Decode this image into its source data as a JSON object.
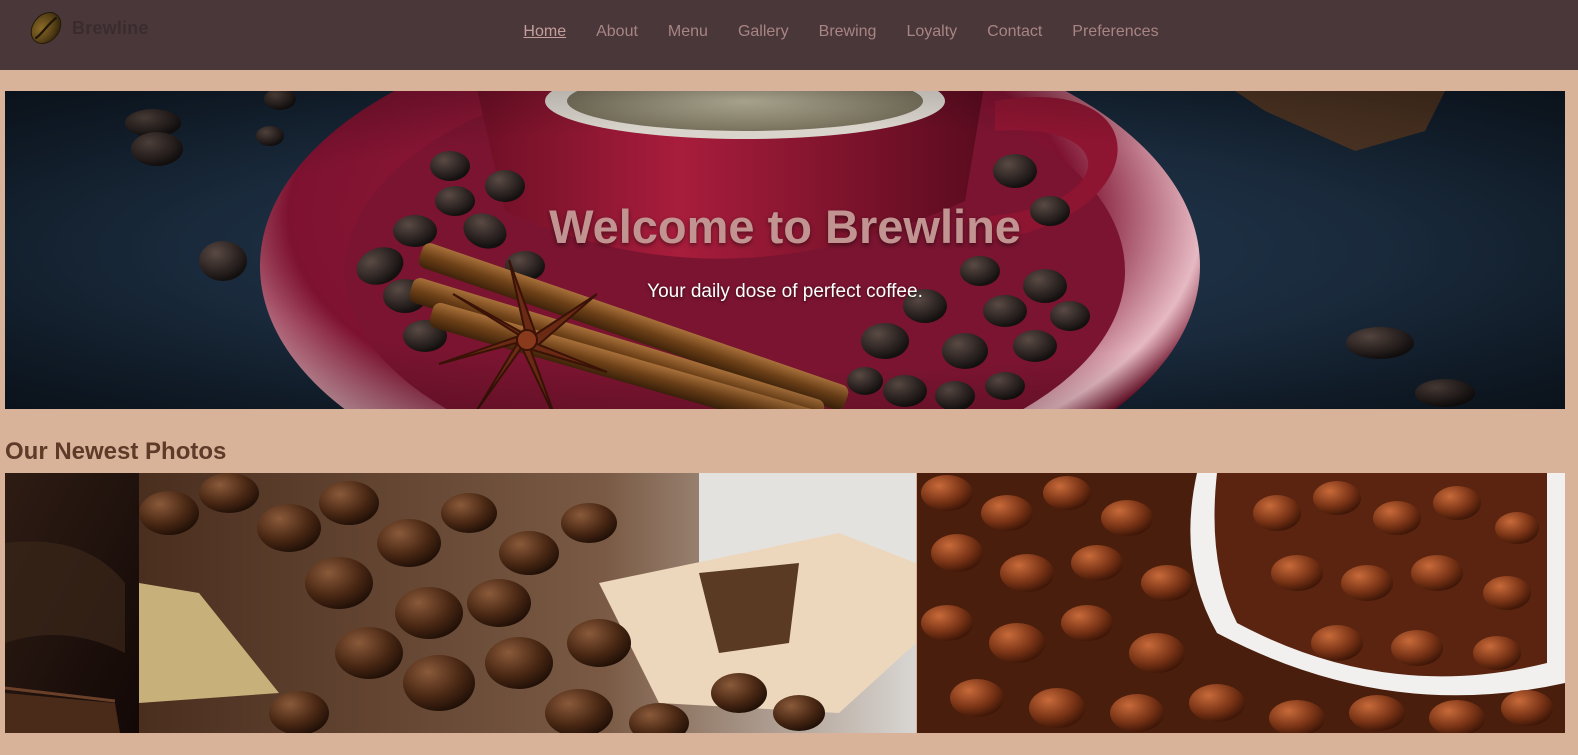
{
  "brand": {
    "name": "Brewline",
    "logo_icon": "coffee-bean-icon"
  },
  "nav": {
    "items": [
      {
        "label": "Home",
        "active": true
      },
      {
        "label": "About",
        "active": false
      },
      {
        "label": "Menu",
        "active": false
      },
      {
        "label": "Gallery",
        "active": false
      },
      {
        "label": "Brewing",
        "active": false
      },
      {
        "label": "Loyalty",
        "active": false
      },
      {
        "label": "Contact",
        "active": false
      },
      {
        "label": "Preferences",
        "active": false
      }
    ]
  },
  "hero": {
    "title": "Welcome to Brewline",
    "subtitle": "Your daily dose of perfect coffee."
  },
  "gallery": {
    "heading": "Our Newest Photos"
  },
  "colors": {
    "navbar_bg": "#4a373a",
    "page_bg": "#d9b29a",
    "nav_link": "#a88583",
    "hero_title": "#c29491",
    "section_heading": "#5e3a28"
  }
}
